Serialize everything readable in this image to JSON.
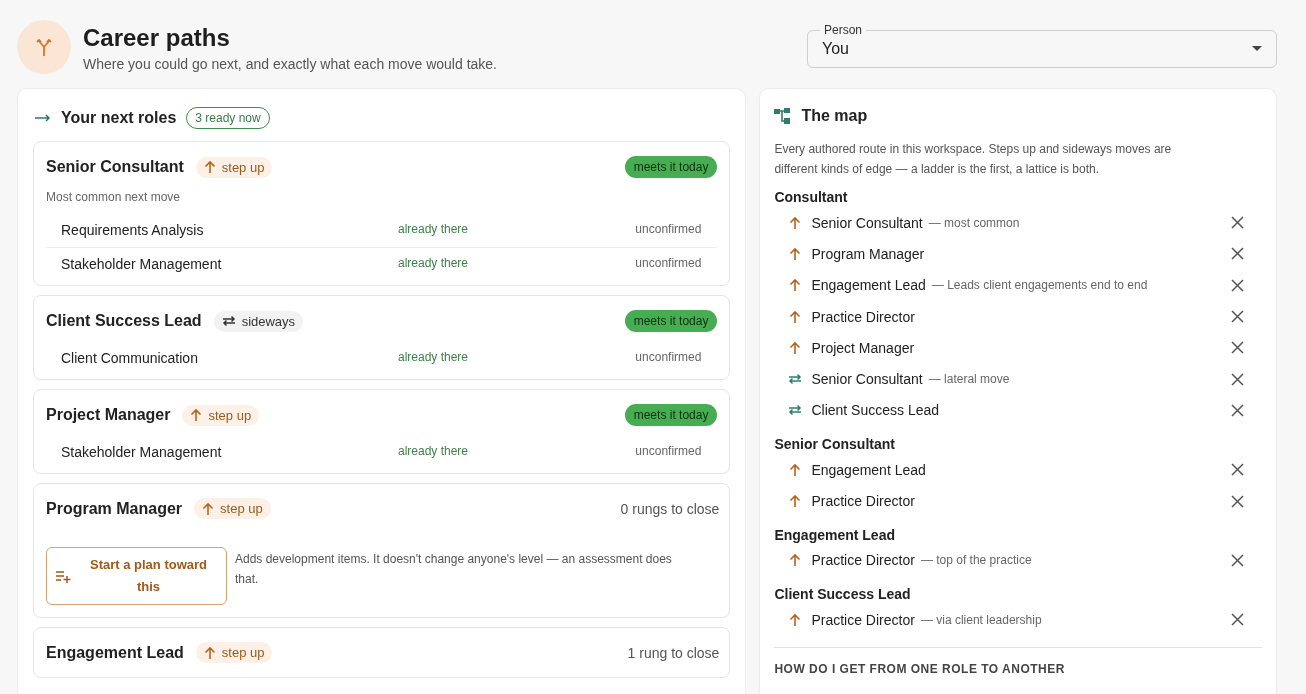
{
  "header": {
    "title": "Career paths",
    "subtitle": "Where you could go next, and exactly what each move would take."
  },
  "person_select": {
    "label": "Person",
    "value": "You"
  },
  "next_roles": {
    "title": "Your next roles",
    "badge": "3 ready now",
    "roles": [
      {
        "title": "Senior Consultant",
        "kind": "up",
        "move_label": "step up",
        "status": {
          "kind": "ready",
          "text": "meets it today"
        },
        "subtitle": "Most common next move",
        "skills": [
          {
            "name": "Requirements Analysis",
            "state": "already there",
            "confirmation": "unconfirmed"
          },
          {
            "name": "Stakeholder Management",
            "state": "already there",
            "confirmation": "unconfirmed"
          }
        ]
      },
      {
        "title": "Client Success Lead",
        "kind": "sideways",
        "move_label": "sideways",
        "status": {
          "kind": "ready",
          "text": "meets it today"
        },
        "skills": [
          {
            "name": "Client Communication",
            "state": "already there",
            "confirmation": "unconfirmed"
          }
        ]
      },
      {
        "title": "Project Manager",
        "kind": "up",
        "move_label": "step up",
        "status": {
          "kind": "ready",
          "text": "meets it today"
        },
        "skills": [
          {
            "name": "Stakeholder Management",
            "state": "already there",
            "confirmation": "unconfirmed"
          }
        ]
      },
      {
        "title": "Program Manager",
        "kind": "up",
        "move_label": "step up",
        "status": {
          "kind": "gap",
          "text": "0 rungs to close"
        },
        "plan_button": "Start a plan toward this",
        "plan_note": "Adds development items. It doesn't change anyone's level — an assessment does that."
      },
      {
        "title": "Engagement Lead",
        "kind": "up",
        "move_label": "step up",
        "status": {
          "kind": "gap",
          "text": "1 rung to close"
        }
      }
    ]
  },
  "map": {
    "title": "The map",
    "description": "Every authored route in this workspace. Steps up and sideways moves are different kinds of edge — a ladder is the first, a lattice is both.",
    "groups": [
      {
        "from": "Consultant",
        "edges": [
          {
            "kind": "up",
            "to": "Senior Consultant",
            "note": "— most common"
          },
          {
            "kind": "up",
            "to": "Program Manager"
          },
          {
            "kind": "up",
            "to": "Engagement Lead",
            "note": "— Leads client engagements end to end"
          },
          {
            "kind": "up",
            "to": "Practice Director"
          },
          {
            "kind": "up",
            "to": "Project Manager"
          },
          {
            "kind": "sideways",
            "to": "Senior Consultant",
            "note": "— lateral move"
          },
          {
            "kind": "sideways",
            "to": "Client Success Lead"
          }
        ]
      },
      {
        "from": "Senior Consultant",
        "edges": [
          {
            "kind": "up",
            "to": "Engagement Lead"
          },
          {
            "kind": "up",
            "to": "Practice Director"
          }
        ]
      },
      {
        "from": "Engagement Lead",
        "edges": [
          {
            "kind": "up",
            "to": "Practice Director",
            "note": "— top of the practice"
          }
        ]
      },
      {
        "from": "Client Success Lead",
        "edges": [
          {
            "kind": "up",
            "to": "Practice Director",
            "note": "— via client leadership"
          }
        ]
      }
    ],
    "section_heading": "HOW DO I GET FROM ONE ROLE TO ANOTHER"
  }
}
